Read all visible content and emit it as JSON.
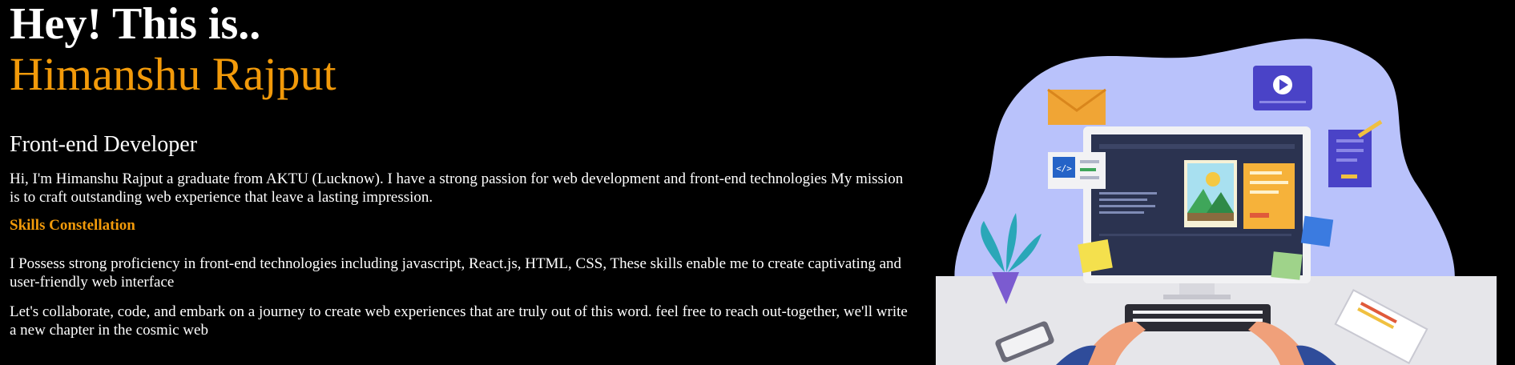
{
  "hero": {
    "greeting": "Hey! This is..",
    "name": "Himanshu Rajput",
    "role": "Front-end Developer",
    "intro": "Hi, I'm Himanshu Rajput a graduate from AKTU (Lucknow). I have a strong passion for web development and front-end technologies My mission is to craft outstanding web experience that leave a lasting impression.",
    "skills_heading": "Skills Constellation",
    "skills_text": "I Possess strong proficiency in front-end technologies including javascript, React.js, HTML, CSS, These skills enable me to create captivating and user-friendly web interface",
    "collab_text": "Let's collaborate, code, and embark on a journey to create web experiences that are truly out of this word. feel free to reach out-together, we'll write a new chapter in the cosmic web"
  },
  "illustration": {
    "icon": "developer-at-desk-illustration",
    "code_badge": "</>"
  },
  "colors": {
    "background": "#000000",
    "accent": "#f29a0a",
    "text": "#ffffff",
    "blob": "#b9c2fb"
  }
}
